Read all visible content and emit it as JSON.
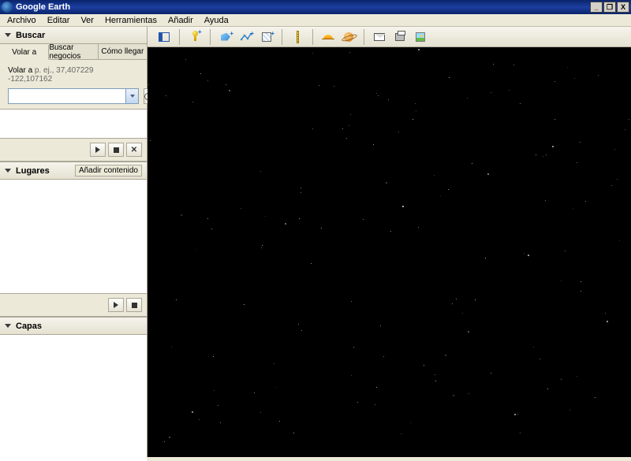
{
  "window": {
    "title": "Google Earth"
  },
  "menu": {
    "archivo": "Archivo",
    "editar": "Editar",
    "ver": "Ver",
    "herramientas": "Herramientas",
    "anadir": "Añadir",
    "ayuda": "Ayuda"
  },
  "sidebar": {
    "search": {
      "title": "Buscar",
      "tabs": {
        "fly": "Volar a",
        "biz": "Buscar negocios",
        "dir": "Cómo llegar"
      },
      "hint_label": "Volar a",
      "hint_example": "p. ej., 37,407229 -122,107162",
      "input_value": ""
    },
    "places": {
      "title": "Lugares",
      "add_button": "Añadir contenido"
    },
    "layers": {
      "title": "Capas"
    }
  },
  "winbuttons": {
    "min": "_",
    "restore": "❐",
    "close": "X"
  },
  "toolbar": {
    "names": {
      "sidepanel": "toggle-sidebar",
      "placemark": "add-placemark",
      "polygon": "add-polygon",
      "path": "add-path",
      "overlay": "add-image-overlay",
      "ruler": "ruler",
      "sun": "sunlight",
      "sky": "switch-sky",
      "email": "email",
      "print": "print",
      "saveimg": "save-image"
    }
  }
}
